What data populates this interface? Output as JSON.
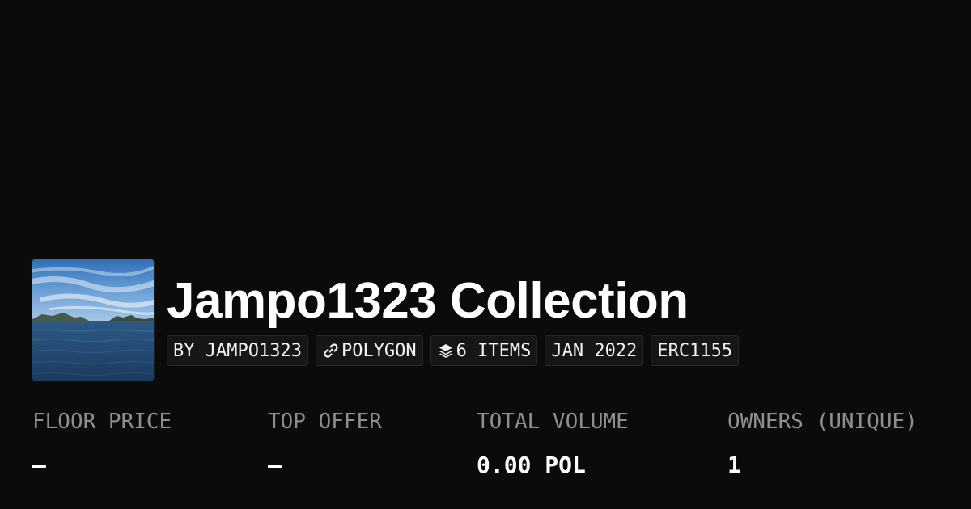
{
  "collection": {
    "title": "Jampo1323 Collection"
  },
  "badges": {
    "creator": "BY JAMPO1323",
    "chain": "POLYGON",
    "chain_icon": "link-icon",
    "items": "6 ITEMS",
    "items_icon": "layers-icon",
    "date": "JAN 2022",
    "standard": "ERC1155"
  },
  "stats": [
    {
      "label": "FLOOR PRICE",
      "value": "—"
    },
    {
      "label": "TOP OFFER",
      "value": "—"
    },
    {
      "label": "TOTAL VOLUME",
      "value": "0.00 POL"
    },
    {
      "label": "OWNERS (UNIQUE)",
      "value": "1"
    }
  ],
  "colors": {
    "background": "#0b0b0b",
    "text": "#ffffff",
    "muted": "#8e8e8e",
    "badge_bg": "#161616"
  }
}
